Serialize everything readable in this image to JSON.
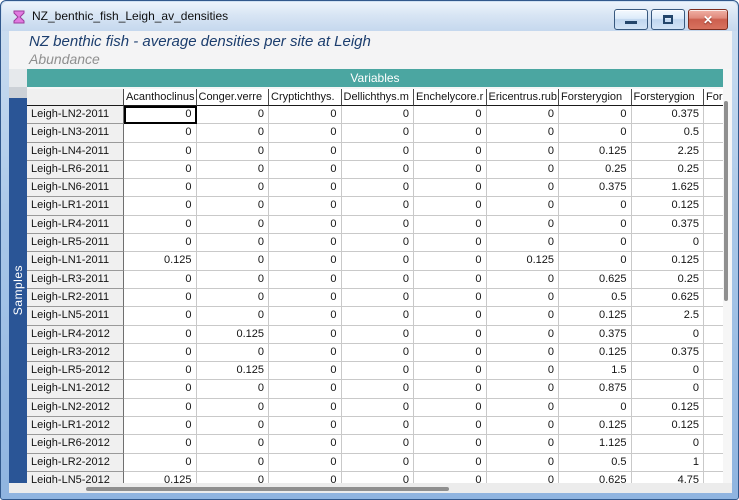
{
  "window": {
    "title": "NZ_benthic_fish_Leigh_av_densities",
    "icon": "worksheet-hourglass-icon",
    "close_glyph": "✕"
  },
  "header": {
    "title": "NZ benthic fish - average densities per site at Leigh",
    "subtitle": "Abundance"
  },
  "colors": {
    "variables_bar": "#4BA6A1",
    "samples_bar": "#2A5596",
    "sheet_title_text": "#1c3e6e",
    "close_button": "#cc5f4e",
    "frame_blue": "#8fb4e0"
  },
  "table": {
    "variables_label": "Variables",
    "samples_label": "Samples",
    "columns": [
      "Acanthoclinus",
      "Conger.verre",
      "Cryptichthys.",
      "Dellichthys.m",
      "Enchelycore.r",
      "Ericentrus.rub",
      "Forsterygion",
      "Forsterygion",
      "Forst"
    ],
    "selected_cell": {
      "row": 0,
      "col": 0
    },
    "rows": [
      {
        "label": "Leigh-LN2-2011",
        "values": [
          "0",
          "0",
          "0",
          "0",
          "0",
          "0",
          "0",
          "0.375",
          ""
        ]
      },
      {
        "label": "Leigh-LN3-2011",
        "values": [
          "0",
          "0",
          "0",
          "0",
          "0",
          "0",
          "0",
          "0.5",
          ""
        ]
      },
      {
        "label": "Leigh-LN4-2011",
        "values": [
          "0",
          "0",
          "0",
          "0",
          "0",
          "0",
          "0.125",
          "2.25",
          ""
        ]
      },
      {
        "label": "Leigh-LR6-2011",
        "values": [
          "0",
          "0",
          "0",
          "0",
          "0",
          "0",
          "0.25",
          "0.25",
          ""
        ]
      },
      {
        "label": "Leigh-LN6-2011",
        "values": [
          "0",
          "0",
          "0",
          "0",
          "0",
          "0",
          "0.375",
          "1.625",
          ""
        ]
      },
      {
        "label": "Leigh-LR1-2011",
        "values": [
          "0",
          "0",
          "0",
          "0",
          "0",
          "0",
          "0",
          "0.125",
          ""
        ]
      },
      {
        "label": "Leigh-LR4-2011",
        "values": [
          "0",
          "0",
          "0",
          "0",
          "0",
          "0",
          "0",
          "0.375",
          ""
        ]
      },
      {
        "label": "Leigh-LR5-2011",
        "values": [
          "0",
          "0",
          "0",
          "0",
          "0",
          "0",
          "0",
          "0",
          ""
        ]
      },
      {
        "label": "Leigh-LN1-2011",
        "values": [
          "0.125",
          "0",
          "0",
          "0",
          "0",
          "0.125",
          "0",
          "0.125",
          ""
        ]
      },
      {
        "label": "Leigh-LR3-2011",
        "values": [
          "0",
          "0",
          "0",
          "0",
          "0",
          "0",
          "0.625",
          "0.25",
          ""
        ]
      },
      {
        "label": "Leigh-LR2-2011",
        "values": [
          "0",
          "0",
          "0",
          "0",
          "0",
          "0",
          "0.5",
          "0.625",
          ""
        ]
      },
      {
        "label": "Leigh-LN5-2011",
        "values": [
          "0",
          "0",
          "0",
          "0",
          "0",
          "0",
          "0.125",
          "2.5",
          ""
        ]
      },
      {
        "label": "Leigh-LR4-2012",
        "values": [
          "0",
          "0.125",
          "0",
          "0",
          "0",
          "0",
          "0.375",
          "0",
          ""
        ]
      },
      {
        "label": "Leigh-LR3-2012",
        "values": [
          "0",
          "0",
          "0",
          "0",
          "0",
          "0",
          "0.125",
          "0.375",
          ""
        ]
      },
      {
        "label": "Leigh-LR5-2012",
        "values": [
          "0",
          "0.125",
          "0",
          "0",
          "0",
          "0",
          "1.5",
          "0",
          ""
        ]
      },
      {
        "label": "Leigh-LN1-2012",
        "values": [
          "0",
          "0",
          "0",
          "0",
          "0",
          "0",
          "0.875",
          "0",
          ""
        ]
      },
      {
        "label": "Leigh-LN2-2012",
        "values": [
          "0",
          "0",
          "0",
          "0",
          "0",
          "0",
          "0",
          "0.125",
          ""
        ]
      },
      {
        "label": "Leigh-LR1-2012",
        "values": [
          "0",
          "0",
          "0",
          "0",
          "0",
          "0",
          "0.125",
          "0.125",
          ""
        ]
      },
      {
        "label": "Leigh-LR6-2012",
        "values": [
          "0",
          "0",
          "0",
          "0",
          "0",
          "0",
          "1.125",
          "0",
          ""
        ]
      },
      {
        "label": "Leigh-LR2-2012",
        "values": [
          "0",
          "0",
          "0",
          "0",
          "0",
          "0",
          "0.5",
          "1",
          ""
        ]
      },
      {
        "label": "Leigh-LN5-2012",
        "values": [
          "0.125",
          "0",
          "0",
          "0",
          "0",
          "0",
          "0.625",
          "4.75",
          ""
        ]
      }
    ]
  }
}
